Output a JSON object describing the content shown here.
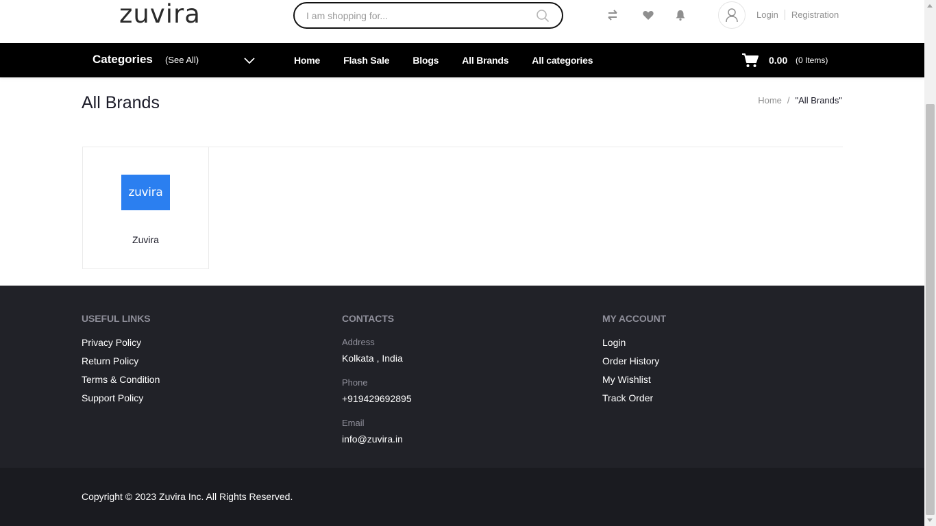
{
  "header": {
    "logo_text": "zuvira",
    "search": {
      "placeholder": "I am shopping for...",
      "value": ""
    },
    "icons": [
      "compare-icon",
      "heart-icon",
      "bell-icon",
      "user-icon"
    ],
    "login_label": "Login",
    "register_label": "Registration"
  },
  "nav": {
    "categories_label": "Categories",
    "see_all_label": "(See All)",
    "links": [
      "Home",
      "Flash Sale",
      "Blogs",
      "All Brands",
      "All categories"
    ],
    "cart_amount": "0.00",
    "cart_items": "(0 Items)"
  },
  "page": {
    "title": "All Brands",
    "breadcrumb": {
      "home": "Home",
      "separator": "/",
      "current": "\"All Brands\""
    }
  },
  "brands": [
    {
      "name": "Zuvira",
      "logo_text": "zuvira",
      "logo_color": "#2b7ff0"
    }
  ],
  "footer": {
    "useful_links": {
      "heading": "USEFUL LINKS",
      "items": [
        "Privacy Policy",
        "Return Policy",
        "Terms & Condition",
        "Support Policy"
      ]
    },
    "contacts": {
      "heading": "CONTACTS",
      "address_label": "Address",
      "address_value": "Kolkata , India",
      "phone_label": "Phone",
      "phone_value": "+919429692895",
      "email_label": "Email",
      "email_value": "info@zuvira.in"
    },
    "my_account": {
      "heading": "MY ACCOUNT",
      "items": [
        "Login",
        "Order History",
        "My Wishlist",
        "Track Order"
      ]
    },
    "copyright": "Copyright ©  2023  Zuvira Inc. All Rights Reserved."
  },
  "colors": {
    "nav_bg": "#000000",
    "footer_bg": "#212228",
    "copyright_bg": "#1a1b20",
    "brand_blue": "#2b7ff0"
  }
}
